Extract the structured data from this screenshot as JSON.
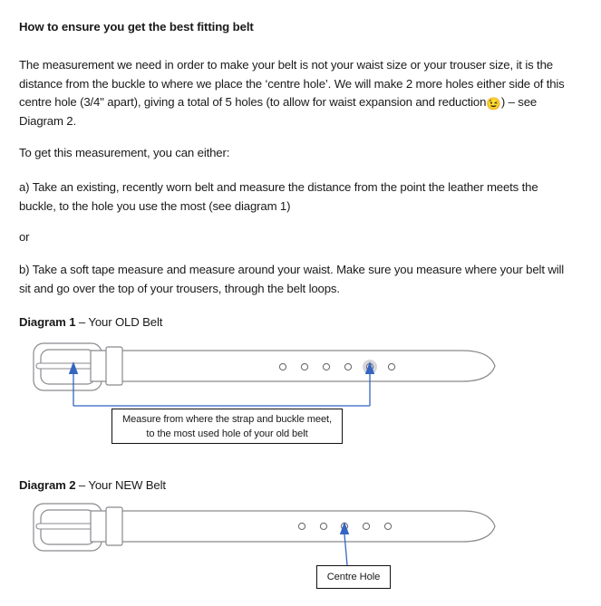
{
  "document": {
    "heading": "How to ensure you get the best fitting belt",
    "paragraphs": {
      "intro_part1": "The measurement we need in order to make your belt is not your waist size or your trouser size, it is the distance from the buckle to where we place the ‘centre hole’.  We will make 2 more holes either side of this centre hole (3/4\" apart), giving a total of 5 holes (to allow for waist expansion and reduction",
      "intro_emoji": "😉",
      "intro_part2": ") – see Diagram 2.",
      "either": "To get this measurement, you can either:",
      "option_a": "a) Take an existing, recently worn belt and measure the distance from the point the leather meets the buckle, to the hole you use the most (see diagram 1)",
      "or": "or",
      "option_b": "b) Take a soft tape measure and measure around your waist.  Make sure you measure where your belt will sit and go over the top of your trousers, through the belt loops."
    }
  },
  "diagram1": {
    "title_bold": "Diagram 1",
    "title_rest": " – Your OLD Belt",
    "callout": {
      "line1": "Measure from where the strap and buckle meet,",
      "line2": "to the most used hole of your old belt"
    },
    "holes_count": 6,
    "highlighted_hole_index": 5,
    "accent_color": "#3465c0",
    "outline_color": "#8a8a8f"
  },
  "diagram2": {
    "title_bold": "Diagram 2",
    "title_rest": " – Your NEW Belt",
    "callout": {
      "label": "Centre Hole"
    },
    "holes_count": 5,
    "pointed_hole_index": 3,
    "accent_color": "#3465c0",
    "outline_color": "#8a8a8f"
  }
}
